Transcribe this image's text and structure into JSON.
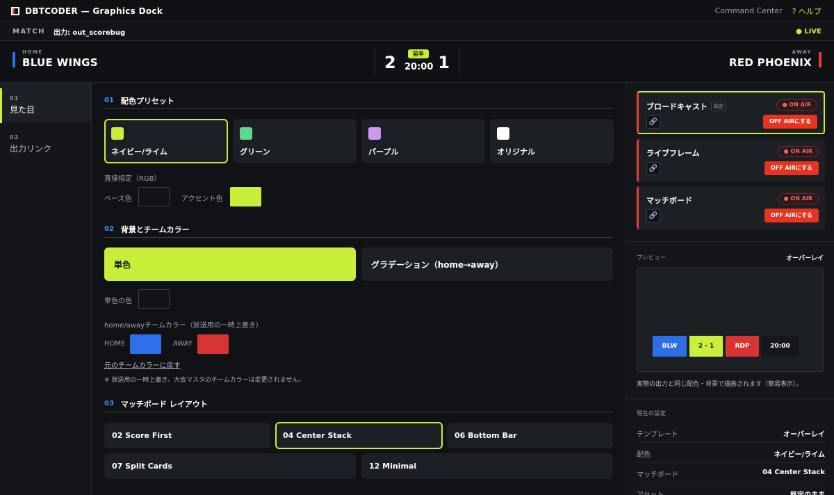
{
  "app": {
    "title": "DBTCODER — Graphics Dock",
    "command_center": "Command Center",
    "help": "? ヘルプ"
  },
  "matchbar": {
    "label": "MATCH",
    "output": "出力: out_scorebug",
    "live": "● LIVE"
  },
  "scoreboard": {
    "home": {
      "side": "HOME",
      "name": "BLUE WINGS",
      "score": "2",
      "color": "#2c6fe8"
    },
    "away": {
      "side": "AWAY",
      "name": "RED PHOENIX",
      "score": "1",
      "color": "#e23d3d"
    },
    "period": "前半",
    "clock": "20:00"
  },
  "nav": [
    {
      "num": "01",
      "label": "見た目",
      "active": true
    },
    {
      "num": "02",
      "label": "出力リンク",
      "active": false
    }
  ],
  "sections": {
    "palette": {
      "num": "01",
      "title": "配色プリセット"
    },
    "background": {
      "num": "02",
      "title": "背景とチームカラー"
    },
    "layout": {
      "num": "03",
      "title": "マッチボード レイアウト"
    }
  },
  "presets": [
    {
      "label": "ネイビー/ライム",
      "color": "#c8f03a",
      "selected": true
    },
    {
      "label": "グリーン",
      "color": "#5fd88f",
      "selected": false
    },
    {
      "label": "パープル",
      "color": "#c79cf0",
      "selected": false
    },
    {
      "label": "オリジナル",
      "color": "#ffffff",
      "selected": false
    }
  ],
  "direct": {
    "label": "直接指定（RGB）",
    "base_label": "ベース色",
    "base_color": "#111317",
    "accent_label": "アクセント色",
    "accent_color": "#c8f03a"
  },
  "background": {
    "solid": "単色",
    "gradient": "グラデーション（home→away）",
    "solid_color_label": "単色の色",
    "solid_color": "#111317",
    "team_colors_label": "home/awayチームカラー（放送用の一時上書き）",
    "home_label": "HOME",
    "home_color": "#2c6fe8",
    "away_label": "AWAY",
    "away_color": "#d93434",
    "reset_link": "元のチームカラーに戻す",
    "note": "※ 放送用の一時上書き。大会マスタのチームカラーは変更されません。"
  },
  "layouts": [
    {
      "label": "02 Score First",
      "selected": false
    },
    {
      "label": "04 Center Stack",
      "selected": true
    },
    {
      "label": "06 Bottom Bar",
      "selected": false
    },
    {
      "label": "07 Split Cards",
      "selected": false
    },
    {
      "label": "12 Minimal",
      "selected": false
    }
  ],
  "outputs": [
    {
      "name": "ブロードキャスト",
      "tag": "既定",
      "status": "● ON AIR",
      "action": "OFF AIRにする",
      "link_icon": "link-icon"
    },
    {
      "name": "ライブフレーム",
      "tag": "",
      "status": "● ON AIR",
      "action": "OFF AIRにする",
      "link_icon": "link-icon"
    },
    {
      "name": "マッチボード",
      "tag": "",
      "status": "● ON AIR",
      "action": "OFF AIRにする",
      "link_icon": "link-icon"
    }
  ],
  "preview": {
    "label": "プレビュー",
    "mode": "オーバーレイ",
    "home_abbr": "BLW",
    "score": "2 - 1",
    "away_abbr": "RDP",
    "clock": "20:00",
    "caption": "実際の出力と同じ配色・背景で描画されます（簡易表示）。"
  },
  "current": {
    "label": "現在の設定",
    "rows": [
      {
        "key": "テンプレート",
        "value": "オーバーレイ"
      },
      {
        "key": "配色",
        "value": "ネイビー/ライム"
      },
      {
        "key": "マッチボード",
        "value": "04 Center Stack"
      },
      {
        "key": "アセット",
        "value": "既定のまま"
      }
    ]
  }
}
